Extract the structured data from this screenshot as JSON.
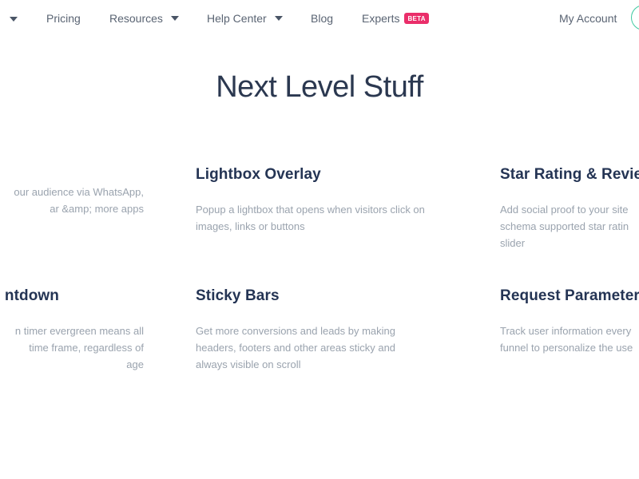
{
  "nav": {
    "items": [
      {
        "label": "Pricing"
      },
      {
        "label": "Resources"
      },
      {
        "label": "Help Center"
      },
      {
        "label": "Blog"
      },
      {
        "label": "Experts",
        "badge": "BETA"
      }
    ],
    "account_label": "My Account",
    "colors": {
      "badge": "#ea2e6a",
      "account_ring": "#3ec9a0"
    }
  },
  "section": {
    "title": "Next Level Stuff"
  },
  "features": [
    {
      "title": "",
      "lines": [
        "our audience via WhatsApp,",
        "ar &amp; more apps"
      ]
    },
    {
      "title": "Lightbox Overlay",
      "lines": [
        "Popup a lightbox that opens when visitors click on",
        "images, links or buttons"
      ]
    },
    {
      "title": "Star Rating & Revie",
      "lines": [
        "Add social proof to your site",
        "schema supported star ratin",
        "slider"
      ]
    },
    {
      "title": "ntdown",
      "lines": [
        "n timer evergreen means all",
        "time frame, regardless of",
        "age"
      ]
    },
    {
      "title": "Sticky Bars",
      "lines": [
        "Get more conversions and leads by making",
        "headers, footers and other areas sticky and",
        "always visible on scroll"
      ]
    },
    {
      "title": "Request Parameter",
      "lines": [
        "Track user information every",
        "funnel to personalize the use"
      ]
    }
  ]
}
